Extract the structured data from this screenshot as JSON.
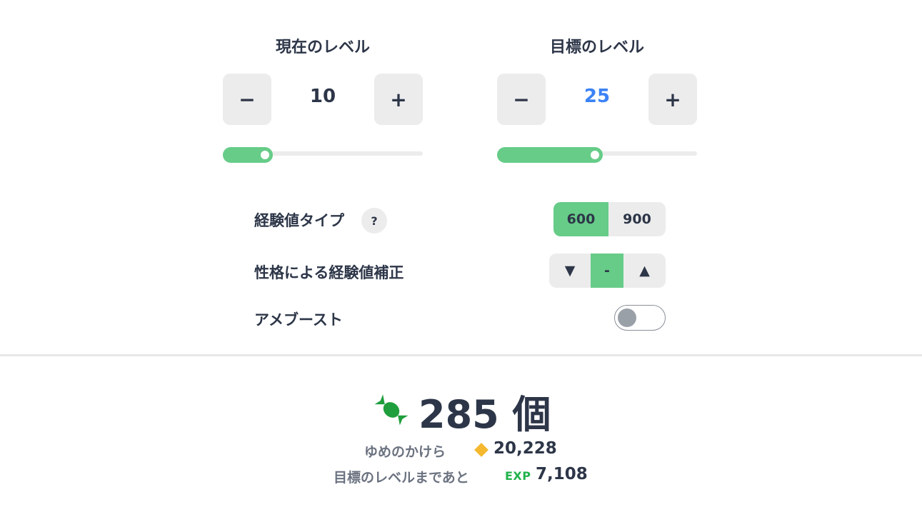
{
  "current_level": {
    "title": "現在のレベル",
    "value": "10",
    "minus_label": "−",
    "plus_label": "+",
    "slider_fraction": 0.21
  },
  "target_level": {
    "title": "目標のレベル",
    "value": "25",
    "value_color": "#3b82f6",
    "minus_label": "−",
    "plus_label": "+",
    "slider_fraction": 0.49
  },
  "exp_type": {
    "label": "経験値タイプ",
    "help_label": "?",
    "options": [
      "600",
      "900"
    ],
    "selected": "600"
  },
  "nature_correction": {
    "label": "性格による経験値補正",
    "options": [
      "▼",
      "-",
      "▲"
    ],
    "selected": "-"
  },
  "candy_boost": {
    "label": "アメブースト",
    "enabled": false
  },
  "result": {
    "candy_count": "285 個",
    "dream_shards_label": "ゆめのかけら",
    "dream_shards_value": "20,228",
    "exp_remaining_label": "目標のレベルまであと",
    "exp_icon_text": "EXP",
    "exp_remaining_value": "7,108"
  },
  "colors": {
    "accent": "#66cc88",
    "text": "#2d3648",
    "target_value": "#3b82f6",
    "candy": "#1e9e3c",
    "diamond": "#f5b82e",
    "exp": "#22b24c"
  }
}
